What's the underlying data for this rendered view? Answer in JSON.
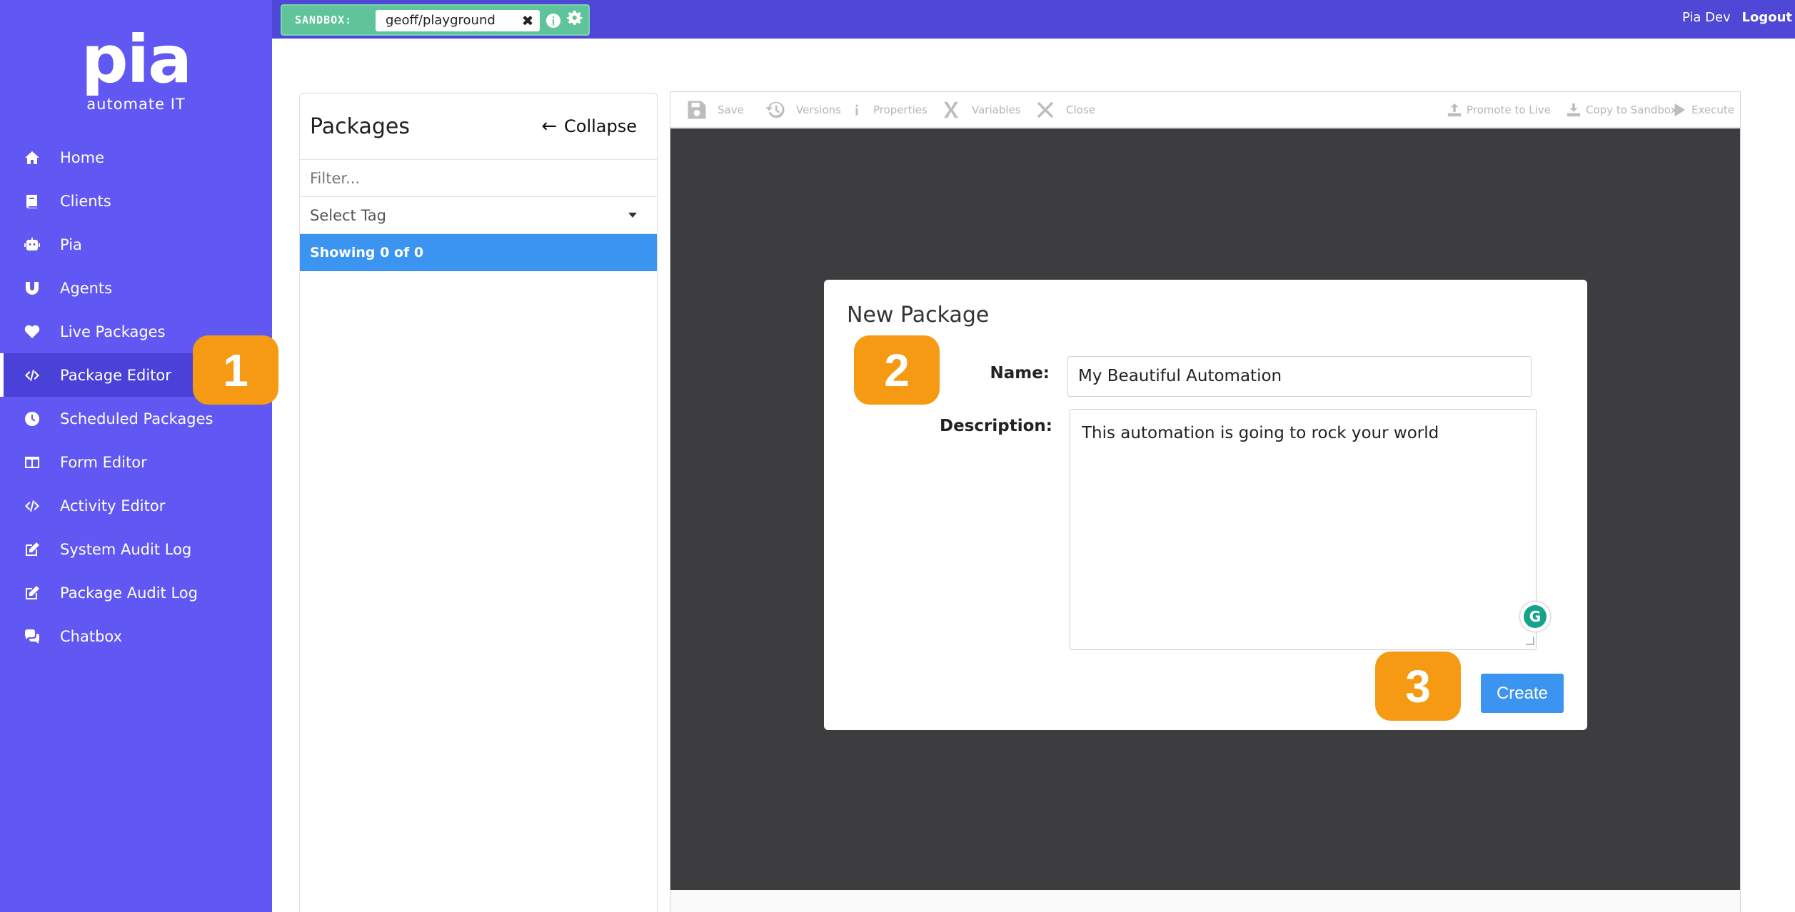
{
  "brand": {
    "name": "pia",
    "tagline": "automate IT"
  },
  "sidebar": {
    "items": [
      {
        "label": "Home",
        "icon": "home-icon"
      },
      {
        "label": "Clients",
        "icon": "book-icon"
      },
      {
        "label": "Pia",
        "icon": "robot-icon"
      },
      {
        "label": "Agents",
        "icon": "magnet-icon"
      },
      {
        "label": "Live Packages",
        "icon": "heartbeat-icon"
      },
      {
        "label": "Package Editor",
        "icon": "code-icon",
        "active": true
      },
      {
        "label": "Scheduled Packages",
        "icon": "clock-icon"
      },
      {
        "label": "Form Editor",
        "icon": "columns-icon"
      },
      {
        "label": "Activity Editor",
        "icon": "code-icon"
      },
      {
        "label": "System Audit Log",
        "icon": "edit-icon"
      },
      {
        "label": "Package Audit Log",
        "icon": "edit-icon"
      },
      {
        "label": "Chatbox",
        "icon": "comments-icon"
      }
    ]
  },
  "topbar": {
    "sandbox_label": "SANDBOX:",
    "sandbox_value": "geoff/playground",
    "clear_glyph": "✖",
    "user_name": "Pia Dev",
    "logout_label": "Logout"
  },
  "packages": {
    "title": "Packages",
    "collapse_label": "Collapse",
    "filter_placeholder": "Filter...",
    "tag_placeholder": "Select Tag",
    "showing_text": "Showing 0 of 0"
  },
  "toolbar": {
    "save": "Save",
    "versions": "Versions",
    "properties": "Properties",
    "variables": "Variables",
    "close": "Close",
    "promote": "Promote to Live",
    "copy": "Copy to Sandbox",
    "execute": "Execute"
  },
  "modal": {
    "title": "New Package",
    "name_label": "Name:",
    "name_value": "My Beautiful Automation",
    "description_label": "Description:",
    "description_value": "This automation is going to rock your world",
    "create_label": "Create",
    "grammarly_glyph": "G"
  },
  "badges": {
    "one": "1",
    "two": "2",
    "three": "3"
  },
  "colors": {
    "sidebar": "#6158f3",
    "topbar": "#4f47d6",
    "sandbox": "#5fc49a",
    "accent": "#3b94f0",
    "badge": "#f59a12",
    "canvas": "#3d3d40"
  }
}
